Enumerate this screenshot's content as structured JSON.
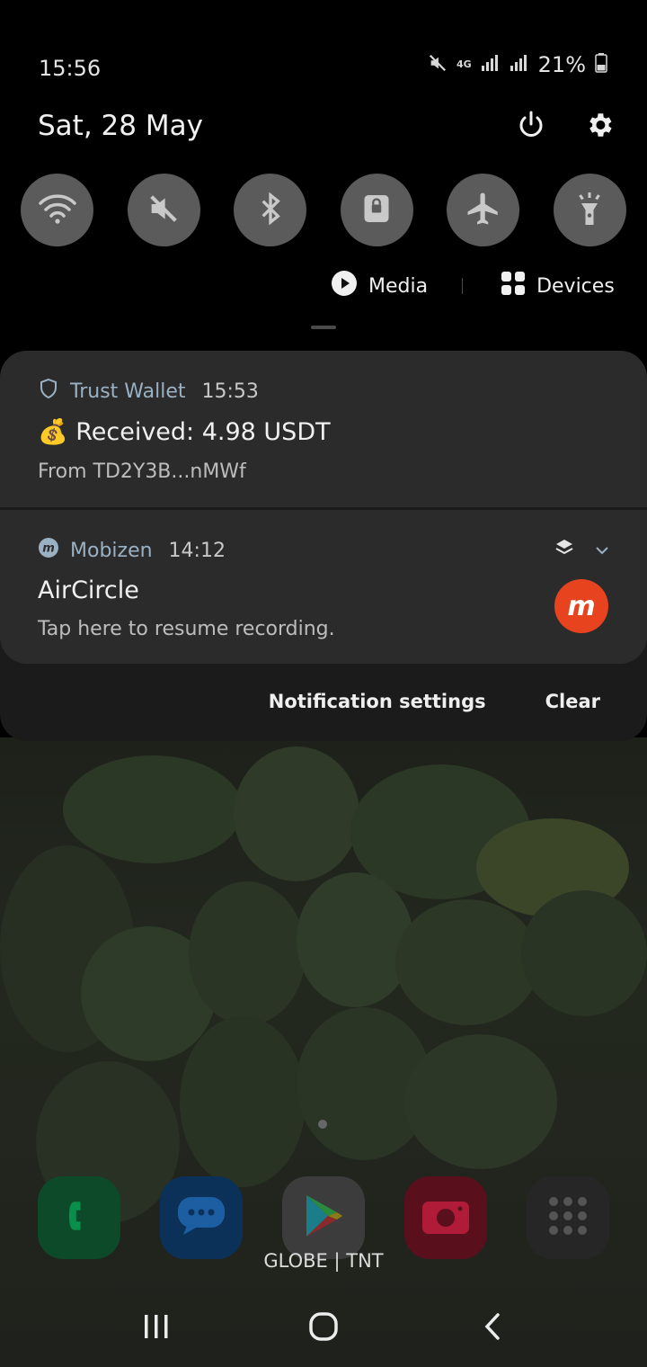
{
  "status": {
    "time": "15:56",
    "battery": "21%",
    "network": "4G"
  },
  "header": {
    "date": "Sat, 28 May"
  },
  "quick_settings": [
    {
      "name": "Wi-Fi",
      "icon": "wifi-icon"
    },
    {
      "name": "Sound",
      "icon": "mute-icon"
    },
    {
      "name": "Bluetooth",
      "icon": "bluetooth-icon"
    },
    {
      "name": "Screen lock",
      "icon": "lock-icon"
    },
    {
      "name": "Airplane mode",
      "icon": "airplane-icon"
    },
    {
      "name": "Flashlight",
      "icon": "flashlight-icon"
    }
  ],
  "media_row": {
    "media_label": "Media",
    "devices_label": "Devices"
  },
  "notifications": [
    {
      "app": "Trust Wallet",
      "time": "15:53",
      "title": "💰 Received: 4.98 USDT",
      "body": "From TD2Y3B...nMWf"
    },
    {
      "app": "Mobizen",
      "time": "14:12",
      "title": "AirCircle",
      "body": "Tap here to resume recording."
    }
  ],
  "notif_actions": {
    "settings": "Notification settings",
    "clear": "Clear"
  },
  "carrier": "GLOBE | TNT",
  "colors": {
    "accent": "#9ab1c4",
    "mobizen": "#e8431f",
    "tile": "#5b5b5b"
  }
}
